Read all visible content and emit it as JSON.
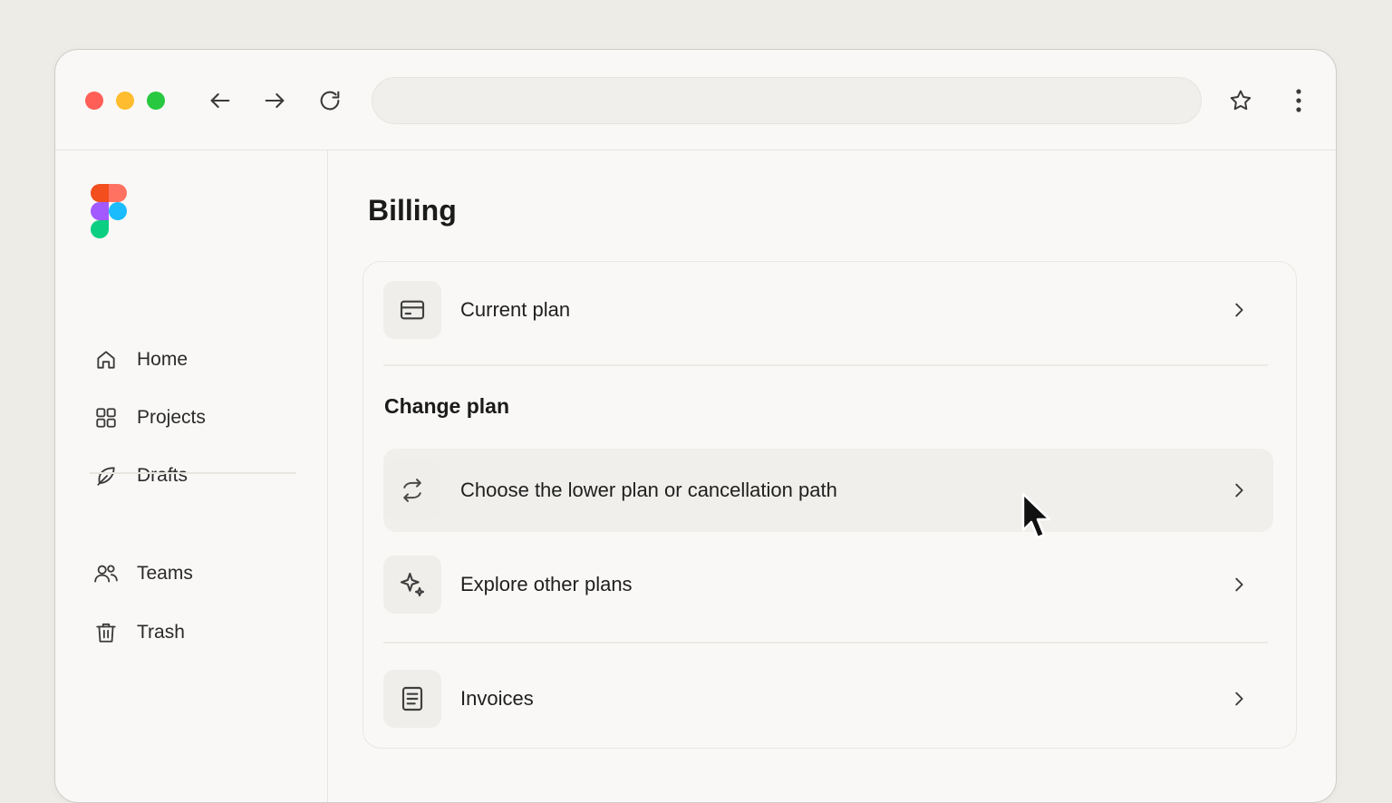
{
  "browser": {
    "traffic_lights": [
      "#ff5f57",
      "#febc2e",
      "#28c840"
    ],
    "nav_icons": [
      "back-arrow-icon",
      "forward-arrow-icon",
      "reload-icon"
    ],
    "address_value": "",
    "right_icons": [
      "star-icon",
      "more-vertical-icon"
    ]
  },
  "sidebar": {
    "logo": "figma-logo",
    "items": [
      {
        "label": "Home",
        "icon": "home-icon"
      },
      {
        "label": "Projects",
        "icon": "grid-icon"
      },
      {
        "label": "Drafts",
        "icon": "leaf-icon"
      },
      {
        "label": "Teams",
        "icon": "users-icon"
      },
      {
        "label": "Trash",
        "icon": "trash-icon"
      }
    ]
  },
  "main": {
    "title": "Billing",
    "current_plan": {
      "label": "Current plan",
      "icon": "credit-card-icon"
    },
    "change_plan_title": "Change plan",
    "change_options": [
      {
        "label": "Choose the lower plan or cancellation path",
        "icon": "swap-arrows-icon",
        "hovered": true
      },
      {
        "label": "Explore other plans",
        "icon": "sparkle-icon",
        "hovered": false
      }
    ],
    "invoices": {
      "label": "Invoices",
      "icon": "document-list-icon"
    }
  },
  "colors": {
    "accent_text": "#1e1e1e",
    "background": "#f9f8f6",
    "hover_row": "#f0efeb"
  }
}
